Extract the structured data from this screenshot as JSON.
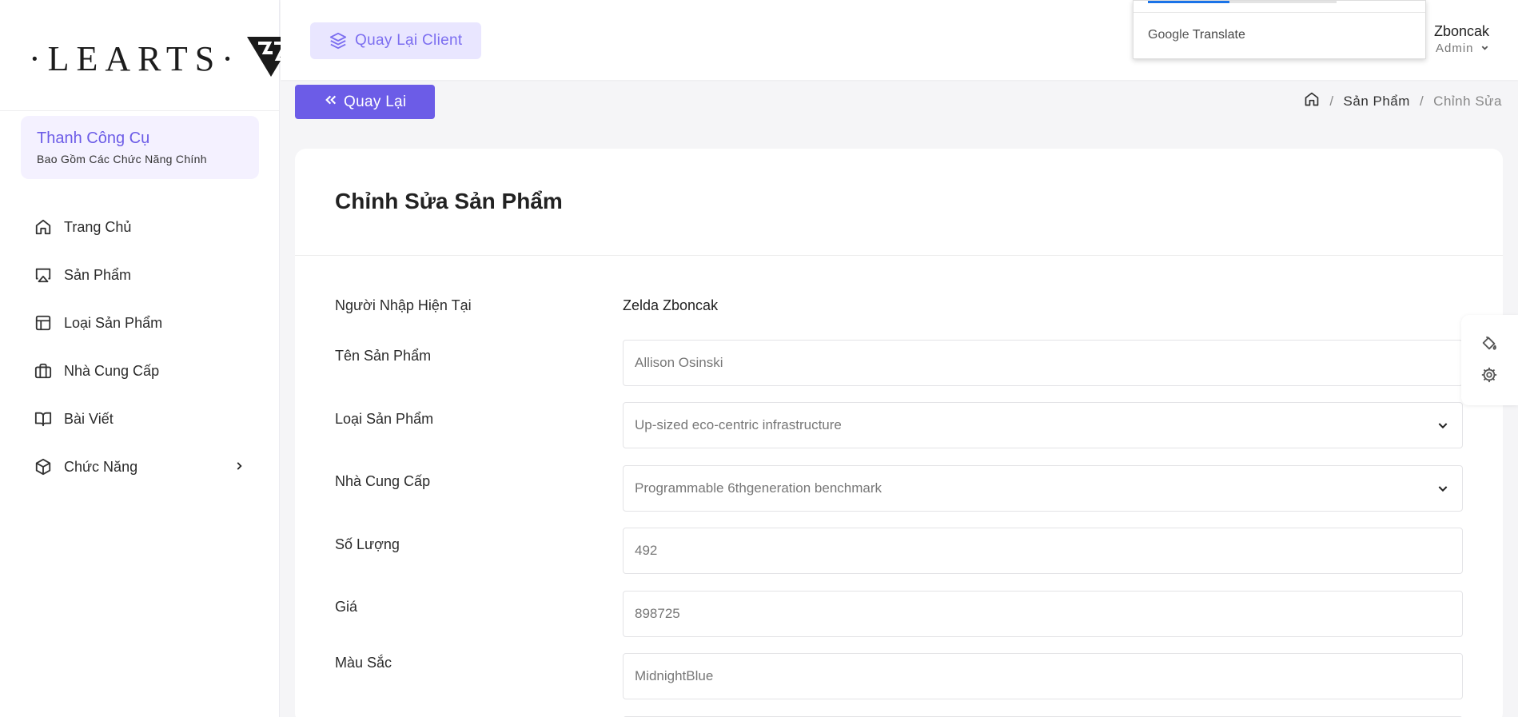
{
  "sidebar": {
    "logo_text": "·LEARTS·",
    "logo_mark": "VF",
    "toolbox": {
      "title": "Thanh Công Cụ",
      "subtitle": "Bao Gồm Các Chức Năng Chính"
    },
    "items": [
      {
        "label": "Trang Chủ",
        "icon": "home-icon"
      },
      {
        "label": "Sản Phẩm",
        "icon": "airplay-icon"
      },
      {
        "label": "Loại Sản Phẩm",
        "icon": "layout-icon"
      },
      {
        "label": "Nhà Cung Cấp",
        "icon": "briefcase-icon"
      },
      {
        "label": "Bài Viết",
        "icon": "book-open-icon"
      },
      {
        "label": "Chức Năng",
        "icon": "box-icon"
      }
    ]
  },
  "header": {
    "client_button": "Quay Lại Client",
    "translate_label": "Google Translate",
    "translate_brand": "Google",
    "translate_word": "Translate",
    "user_name": "Zboncak",
    "user_role": "Admin"
  },
  "toolbar": {
    "back_button": "Quay Lại",
    "breadcrumb": {
      "home_icon": "home-icon",
      "section": "Sản Phẩm",
      "current": "Chỉnh Sửa"
    }
  },
  "form": {
    "title": "Chỉnh Sửa Sản Phẩm",
    "importer_label": "Người Nhập Hiện Tại",
    "importer_value": "Zelda Zboncak",
    "name_label": "Tên Sản Phẩm",
    "name_value": "Allison Osinski",
    "category_label": "Loại Sản Phẩm",
    "category_value": "Up-sized eco-centric infrastructure",
    "supplier_label": "Nhà Cung Cấp",
    "supplier_value": "Programmable 6thgeneration benchmark",
    "quantity_label": "Số Lượng",
    "quantity_value": "492",
    "price_label": "Giá",
    "price_value": "898725",
    "color_label": "Màu Sắc",
    "color_value": "MidnightBlue"
  },
  "colors": {
    "accent": "#6c5ce7",
    "accent_light": "#e9e6ff",
    "background": "#f5f5f7"
  }
}
